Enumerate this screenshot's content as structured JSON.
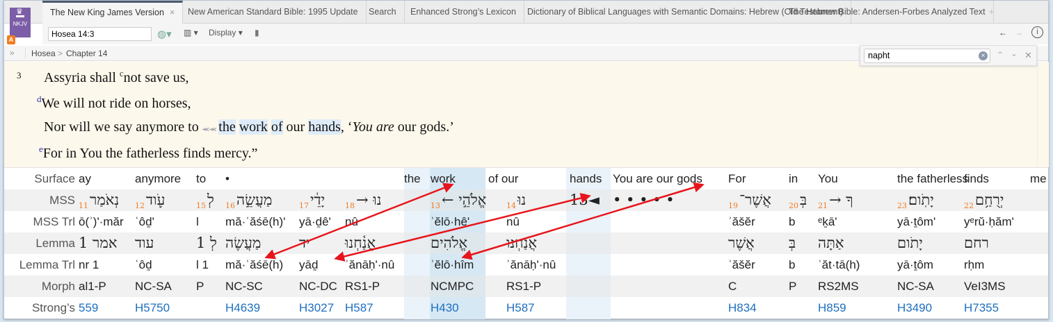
{
  "tabs": [
    {
      "label": "The New King James Version",
      "active": true,
      "close": "×"
    },
    {
      "label": "New American Standard Bible: 1995 Update"
    },
    {
      "label": "Search"
    },
    {
      "label": "Enhanced Strong’s Lexicon"
    },
    {
      "label": "Dictionary of Biblical Languages with Semantic Domains: Hebrew (Old Testament)"
    },
    {
      "label": "The Hebrew Bible: Andersen-Forbes Analyzed Text"
    }
  ],
  "new_tab": "+",
  "logo": {
    "abbr": "NKJV",
    "badge": "A"
  },
  "toolbar": {
    "reference": "Hosea 14:3",
    "display": "Display"
  },
  "breadcrumb": {
    "expand": "»",
    "book": "Hosea",
    "sep": ">",
    "chapter": "Chapter 14"
  },
  "find": {
    "value": "napht"
  },
  "verse": {
    "number": "3",
    "l1a": "Assyria shall ",
    "l1n": "c",
    "l1b": "not save us,",
    "l2n": "d",
    "l2": "We will not ride on horses,",
    "l3a": "Nor will we say anymore to ",
    "l3b": "the",
    "l3c": "work",
    "l3d": "of",
    "l3e": " our ",
    "l3f": "hands",
    ", ‘": "",
    "l3g": ", ‘",
    "l3h": "You are",
    "l3i": " our gods.’",
    "l4n": "e",
    "l4": "For in You the fatherless finds mercy.”"
  },
  "row_labels": [
    "Surface",
    "MSS",
    "MSS Trl",
    "Lemma",
    "Lemma Trl",
    "Morph",
    "Strong’s"
  ],
  "columns": [
    {
      "surface": "ay",
      "num": "11",
      "mss": "נְאֹמַר",
      "mss_trl": "ō(ʾ)ʹ·măr",
      "lemma": "אמר 1",
      "lemma_trl": "nr 1",
      "morph": "al1-P",
      "strongs": "559"
    },
    {
      "surface": "anymore",
      "num": "12",
      "mss": "עֹ֛וד",
      "mss_trl": "ʿôḏʹ",
      "lemma": "עוד",
      "lemma_trl": "ʿôḏ",
      "morph": "NC-SA",
      "strongs": "H5750"
    },
    {
      "surface": "to",
      "num": "15",
      "mss": "לְ",
      "mss_trl": "l",
      "lemma": "לְ 1",
      "lemma_trl": "l 1",
      "morph": "P",
      "strongs": ""
    },
    {
      "surface": "•",
      "num": "16",
      "mss": "מַעֲשֵׂ֣ה",
      "mss_trl": "mă·ʿăśē(h)ʹ",
      "lemma": "מַעֲשֶׂה",
      "lemma_trl": "mă·ʿăśē(h)",
      "morph": "NC-SC",
      "strongs": "H4639"
    },
    {
      "surface": "",
      "num": "17",
      "mss": "יָדֵ֔י",
      "mss_trl": "yā·ḏêʹ",
      "lemma": "יד",
      "lemma_trl": "yāḏ",
      "morph": "NC-DC",
      "strongs": "H3027"
    },
    {
      "surface": "",
      "num": "18",
      "mss": "→ נוּ",
      "mss_trl": "nû",
      "lemma": "אֲנַ֫חְנוּ",
      "lemma_trl": "ʾănāḥʹ·nû",
      "morph": "RS1-P",
      "strongs": "H587"
    },
    {
      "surface": "the",
      "num": "",
      "mss": "",
      "mss_trl": "",
      "lemma": "",
      "lemma_trl": "",
      "morph": "",
      "strongs": ""
    },
    {
      "surface": "work",
      "num": "13",
      "mss": "← אֱלֹהֵ֣י",
      "mss_trl": "ʾĕlō·hêʹ",
      "lemma": "אֱלֹהִים",
      "lemma_trl": "ʾĕlō·hîm",
      "morph": "NCMPC",
      "strongs": "H430"
    },
    {
      "surface": "of our",
      "num": "",
      "mss": "",
      "mss_trl": "",
      "lemma": "",
      "lemma_trl": "",
      "morph": "",
      "strongs": ""
    },
    {
      "surface": "",
      "num": "14",
      "mss": "נוּ",
      "mss_trl": "nû",
      "lemma": "אֲנַחְנוּ",
      "lemma_trl": "ʾănāḥʹ·nû",
      "morph": "RS1-P",
      "strongs": "H587"
    },
    {
      "surface": "hands",
      "num": "",
      "mss": "◄13",
      "mss_trl": "",
      "lemma": "",
      "lemma_trl": "",
      "morph": "",
      "strongs": ""
    },
    {
      "surface": "You are our gods",
      "num": "",
      "mss": "•    •    •    •    •",
      "mss_trl": "",
      "lemma": "",
      "lemma_trl": "",
      "morph": "",
      "strongs": ""
    },
    {
      "surface": "For",
      "num": "19",
      "mss": "אֲשֶׁר־",
      "mss_trl": "ʾăšĕr",
      "lemma": "אֲשֶׁר",
      "lemma_trl": "ʾăšĕr",
      "morph": "C",
      "strongs": "H834"
    },
    {
      "surface": "in",
      "num": "20",
      "mss": "בְּ",
      "mss_trl": "b",
      "lemma": "בְּ",
      "lemma_trl": "b",
      "morph": "P",
      "strongs": ""
    },
    {
      "surface": "You",
      "num": "21",
      "mss": "→ ךָ",
      "mss_trl": "ᵉḵāʹ",
      "lemma": "אַתָּה",
      "lemma_trl": "ʾăt·tā(h)",
      "morph": "RS2MS",
      "strongs": "H859"
    },
    {
      "surface": "the fatherless",
      "num": "23",
      "mss": "יָתֹֽום׃",
      "mss_trl": "yā·ṯômʹ",
      "lemma": "יָתֹום",
      "lemma_trl": "yā·ṯôm",
      "morph": "NC-SA",
      "strongs": "H3490"
    },
    {
      "surface": "finds",
      "num": "22",
      "mss": "יְרֻחַ֥ם",
      "mss_trl": "yᵉrŭ·ḥămʹ",
      "lemma": "רחם",
      "lemma_trl": "rḥm",
      "morph": "VeI3MS",
      "strongs": "H7355"
    },
    {
      "surface": "me",
      "num": "",
      "mss": "",
      "mss_trl": "",
      "lemma": "",
      "lemma_trl": "",
      "morph": "",
      "strongs": ""
    }
  ],
  "colors": {
    "accent": "#7b5ea7",
    "arrow": "#e8141b",
    "strongs": "#1f6fbf",
    "number": "#f47a20"
  }
}
